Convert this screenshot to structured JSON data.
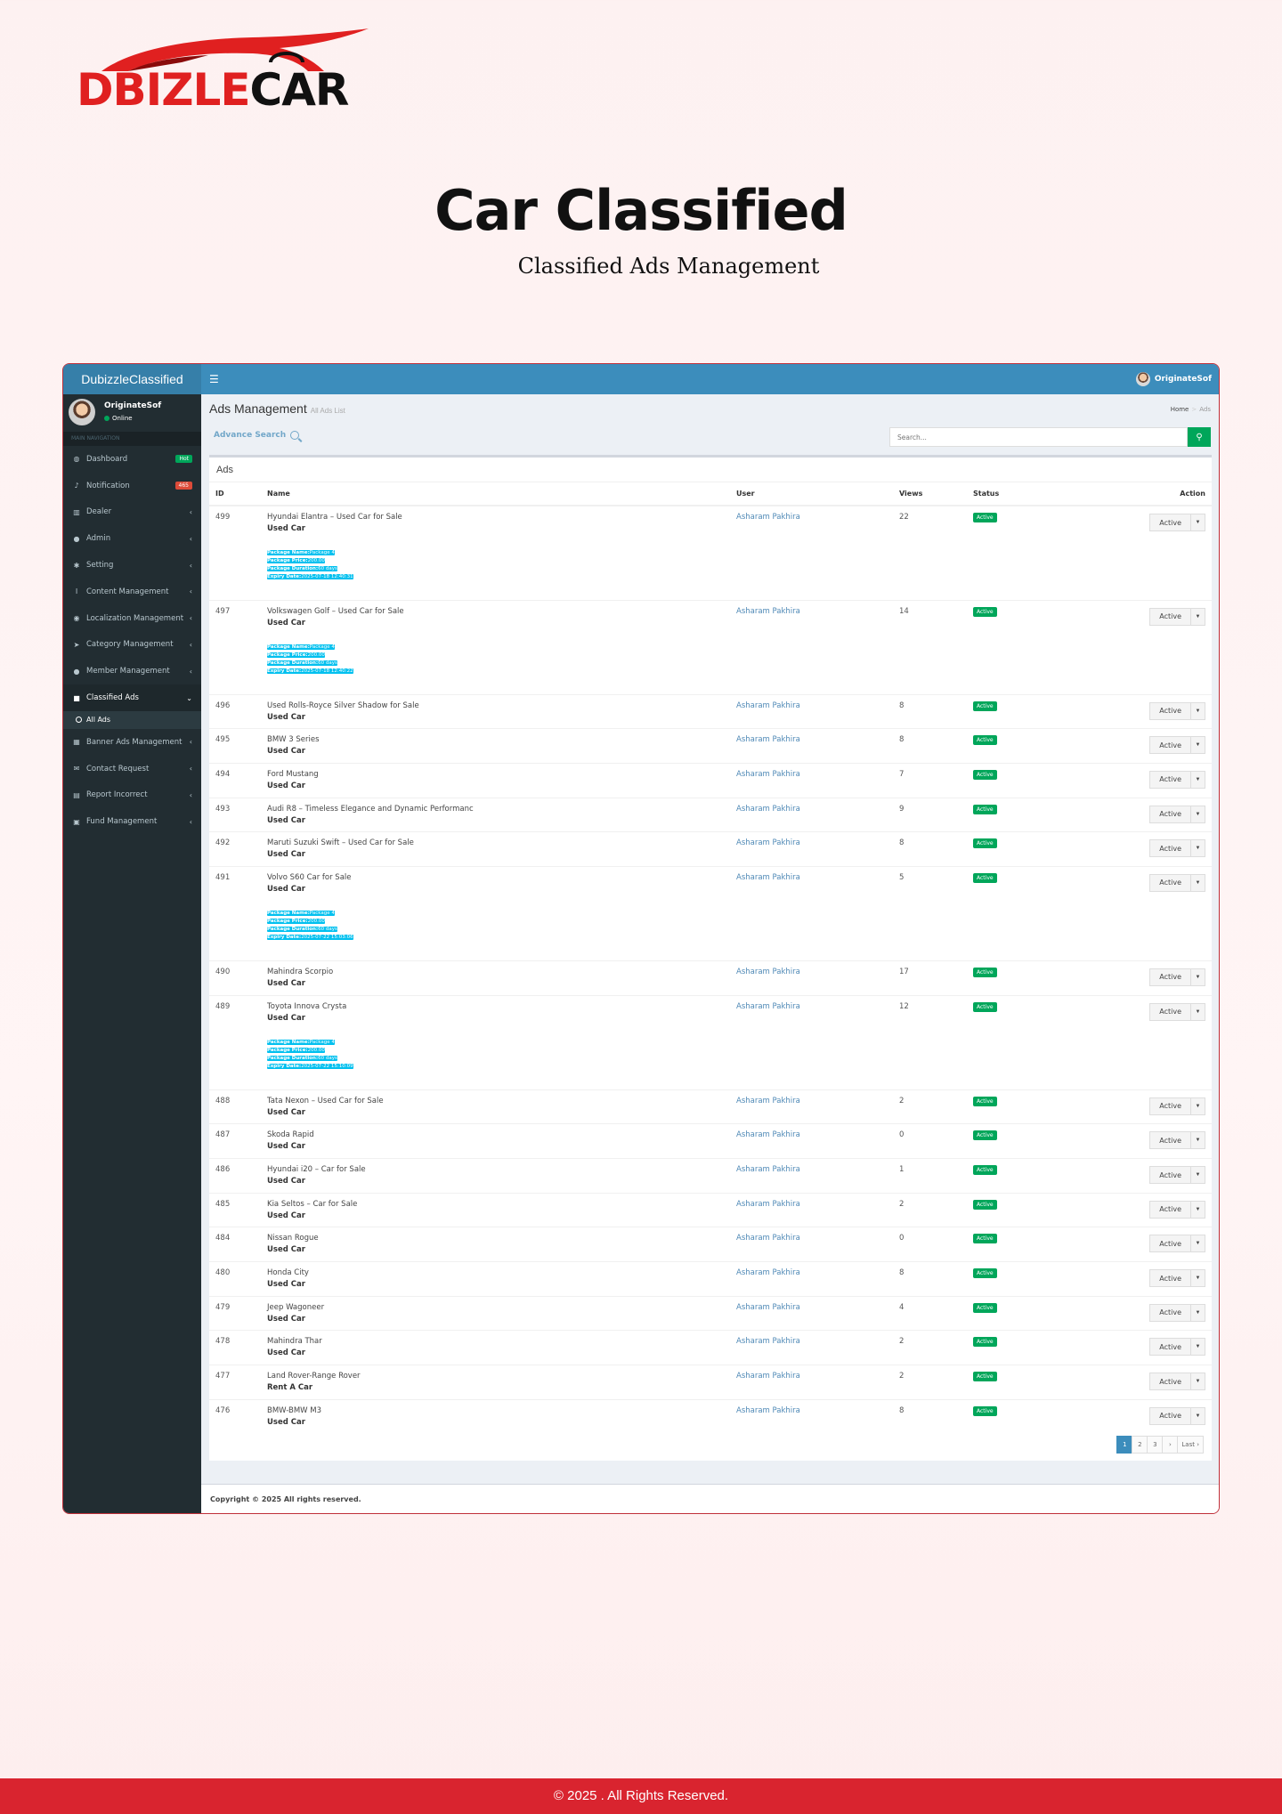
{
  "logo": {
    "part1": "DBIZLE",
    "part2": "CAR"
  },
  "hero": {
    "title": "Car Classified",
    "subtitle": "Classified Ads Management"
  },
  "app": {
    "brand": "DubizzleClassified",
    "top_user": "OriginateSof",
    "sidebar": {
      "user_name": "OriginateSof",
      "user_status": "Online",
      "nav_header": "MAIN NAVIGATION",
      "items": [
        {
          "label": "Dashboard",
          "icon": "dashboard-icon",
          "glyph": "◍",
          "badge": "Hot",
          "badge_color": "#00a65a"
        },
        {
          "label": "Notification",
          "icon": "bell-icon",
          "glyph": "♪",
          "badge": "465",
          "badge_color": "#dd4b39"
        },
        {
          "label": "Dealer",
          "icon": "chart-icon",
          "glyph": "▥"
        },
        {
          "label": "Admin",
          "icon": "user-icon",
          "glyph": "●"
        },
        {
          "label": "Setting",
          "icon": "gear-icon",
          "glyph": "✱"
        },
        {
          "label": "Content Management",
          "icon": "text-cursor-icon",
          "glyph": "I"
        },
        {
          "label": "Localization Management",
          "icon": "map-marker-icon",
          "glyph": "◉"
        },
        {
          "label": "Category Management",
          "icon": "pointer-icon",
          "glyph": "➤"
        },
        {
          "label": "Member Management",
          "icon": "users-icon",
          "glyph": "●"
        },
        {
          "label": "Classified Ads",
          "icon": "folder-icon",
          "glyph": "■",
          "active": true,
          "sub": "All Ads"
        },
        {
          "label": "Banner Ads Management",
          "icon": "calendar-icon",
          "glyph": "▦"
        },
        {
          "label": "Contact Request",
          "icon": "envelope-icon",
          "glyph": "✉"
        },
        {
          "label": "Report Incorrect",
          "icon": "file-icon",
          "glyph": "▤"
        },
        {
          "label": "Fund Management",
          "icon": "money-icon",
          "glyph": "▣"
        }
      ]
    },
    "main": {
      "title": "Ads Management",
      "subtitle": "All Ads List",
      "breadcrumb": {
        "home": "Home",
        "current": "Ads"
      },
      "advanced_search": "Advance Search",
      "search_placeholder": "Search...",
      "box_title": "Ads",
      "columns": {
        "id": "ID",
        "name": "Name",
        "user": "User",
        "views": "Views",
        "status": "Status",
        "action": "Action"
      },
      "pkg_labels": {
        "name": "Package Name:",
        "price": "Package Price:",
        "duration": "Package Duration:",
        "expiry": "Expiry Date:"
      },
      "rows": [
        {
          "id": "499",
          "name": "Hyundai Elantra – Used Car for Sale",
          "category": "Used Car",
          "user": "Asharam Pakhira",
          "views": "22",
          "status": "Active",
          "action": "Active",
          "package": {
            "name": "Package 4",
            "price": "200.00",
            "duration": "60 days",
            "expiry": "2025-07-18 12:40:31"
          }
        },
        {
          "id": "497",
          "name": "Volkswagen Golf – Used Car for Sale",
          "category": "Used Car",
          "user": "Asharam Pakhira",
          "views": "14",
          "status": "Active",
          "action": "Active",
          "package": {
            "name": "Package 4",
            "price": "200.00",
            "duration": "60 days",
            "expiry": "2025-07-18 12:40:22"
          }
        },
        {
          "id": "496",
          "name": "Used Rolls-Royce Silver Shadow for Sale",
          "category": "Used Car",
          "user": "Asharam Pakhira",
          "views": "8",
          "status": "Active",
          "action": "Active"
        },
        {
          "id": "495",
          "name": "BMW 3 Series",
          "category": "Used Car",
          "user": "Asharam Pakhira",
          "views": "8",
          "status": "Active",
          "action": "Active"
        },
        {
          "id": "494",
          "name": "Ford Mustang",
          "category": "Used Car",
          "user": "Asharam Pakhira",
          "views": "7",
          "status": "Active",
          "action": "Active"
        },
        {
          "id": "493",
          "name": "Audi R8 – Timeless Elegance and Dynamic Performanc",
          "category": "Used Car",
          "user": "Asharam Pakhira",
          "views": "9",
          "status": "Active",
          "action": "Active"
        },
        {
          "id": "492",
          "name": "Maruti Suzuki Swift – Used Car for Sale",
          "category": "Used Car",
          "user": "Asharam Pakhira",
          "views": "8",
          "status": "Active",
          "action": "Active"
        },
        {
          "id": "491",
          "name": "Volvo S60 Car for Sale",
          "category": "Used Car",
          "user": "Asharam Pakhira",
          "views": "5",
          "status": "Active",
          "action": "Active",
          "package": {
            "name": "Package 4",
            "price": "200.00",
            "duration": "60 days",
            "expiry": "2025-07-22 15:03:06"
          }
        },
        {
          "id": "490",
          "name": "Mahindra Scorpio",
          "category": "Used Car",
          "user": "Asharam Pakhira",
          "views": "17",
          "status": "Active",
          "action": "Active"
        },
        {
          "id": "489",
          "name": "Toyota Innova Crysta",
          "category": "Used Car",
          "user": "Asharam Pakhira",
          "views": "12",
          "status": "Active",
          "action": "Active",
          "package": {
            "name": "Package 4",
            "price": "200.00",
            "duration": "60 days",
            "expiry": "2025-07-22 15:10:09"
          }
        },
        {
          "id": "488",
          "name": "Tata Nexon – Used Car for Sale",
          "category": "Used Car",
          "user": "Asharam Pakhira",
          "views": "2",
          "status": "Active",
          "action": "Active"
        },
        {
          "id": "487",
          "name": "Skoda Rapid",
          "category": "Used Car",
          "user": "Asharam Pakhira",
          "views": "0",
          "status": "Active",
          "action": "Active"
        },
        {
          "id": "486",
          "name": "Hyundai i20 – Car for Sale",
          "category": "Used Car",
          "user": "Asharam Pakhira",
          "views": "1",
          "status": "Active",
          "action": "Active"
        },
        {
          "id": "485",
          "name": "Kia Seltos – Car for Sale",
          "category": "Used Car",
          "user": "Asharam Pakhira",
          "views": "2",
          "status": "Active",
          "action": "Active"
        },
        {
          "id": "484",
          "name": "Nissan Rogue",
          "category": "Used Car",
          "user": "Asharam Pakhira",
          "views": "0",
          "status": "Active",
          "action": "Active"
        },
        {
          "id": "480",
          "name": "Honda City",
          "category": "Used Car",
          "user": "Asharam Pakhira",
          "views": "8",
          "status": "Active",
          "action": "Active"
        },
        {
          "id": "479",
          "name": "Jeep Wagoneer",
          "category": "Used Car",
          "user": "Asharam Pakhira",
          "views": "4",
          "status": "Active",
          "action": "Active"
        },
        {
          "id": "478",
          "name": "Mahindra Thar",
          "category": "Used Car",
          "user": "Asharam Pakhira",
          "views": "2",
          "status": "Active",
          "action": "Active"
        },
        {
          "id": "477",
          "name": "Land Rover-Range Rover",
          "category": "Rent A Car",
          "user": "Asharam Pakhira",
          "views": "2",
          "status": "Active",
          "action": "Active"
        },
        {
          "id": "476",
          "name": "BMW-BMW M3",
          "category": "Used Car",
          "user": "Asharam Pakhira",
          "views": "8",
          "status": "Active",
          "action": "Active"
        }
      ],
      "pagination": [
        "1",
        "2",
        "3",
        "›",
        "Last ›"
      ],
      "current_page": "1"
    },
    "footer": "Copyright © 2025 All rights reserved."
  },
  "site_footer": "© 2025 . All Rights Reserved.",
  "colors": {
    "brand_blue": "#3c8dbc",
    "sidebar": "#222d32",
    "success": "#00a65a",
    "info": "#00c0ef",
    "footer_red": "#d9242f"
  }
}
